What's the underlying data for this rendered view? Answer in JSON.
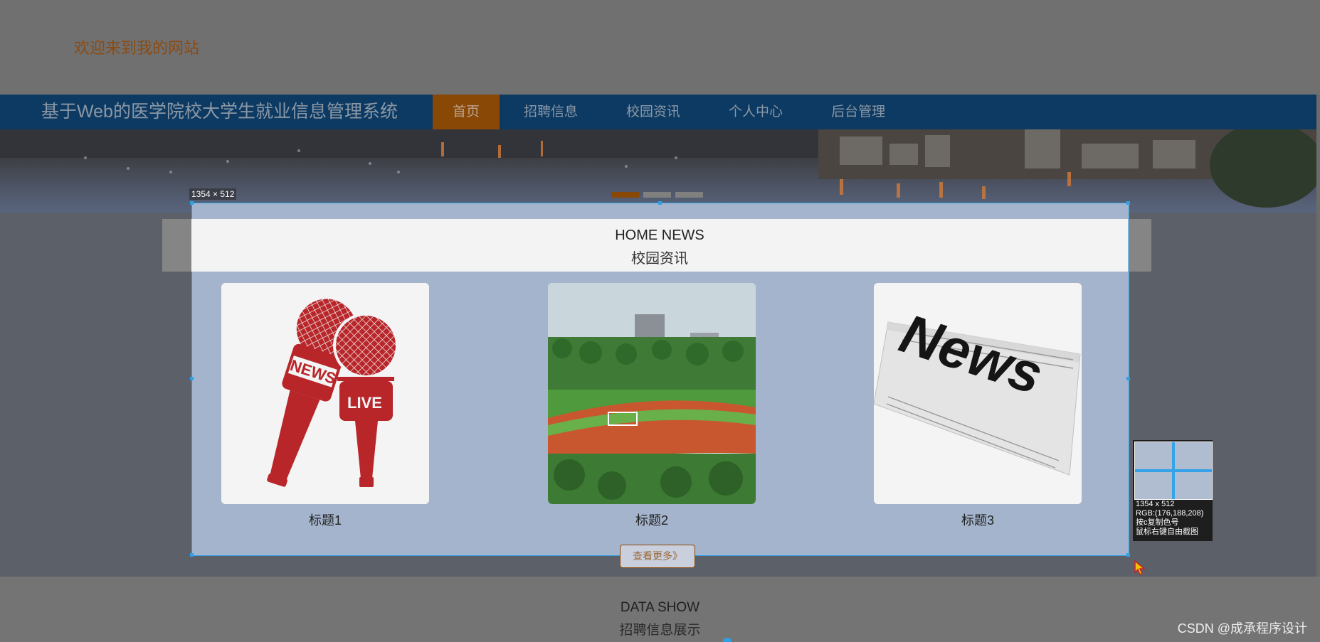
{
  "header": {
    "welcome": "欢迎来到我的网站"
  },
  "nav": {
    "site_title": "基于Web的医学院校大学生就业信息管理系统",
    "items": [
      {
        "label": "首页",
        "active": true
      },
      {
        "label": "招聘信息",
        "active": false
      },
      {
        "label": "校园资讯",
        "active": false
      },
      {
        "label": "个人中心",
        "active": false
      },
      {
        "label": "后台管理",
        "active": false
      }
    ]
  },
  "carousel": {
    "slides": 3,
    "active_slide": 1
  },
  "news": {
    "title_en": "HOME NEWS",
    "title_cn": "校园资讯",
    "cards": [
      {
        "title": "标题1",
        "image": "news-microphones-image",
        "mic_labels": [
          "NEWS",
          "LIVE"
        ]
      },
      {
        "title": "标题2",
        "image": "campus-track-image"
      },
      {
        "title": "标题3",
        "image": "newspaper-image",
        "paper_text": "News"
      }
    ],
    "more_label": "查看更多》"
  },
  "screenshot_tool": {
    "size_label": "1354 × 512",
    "magnifier": {
      "size": "1354 x 512",
      "rgb": "RGB:(176,188,208)",
      "hint_copy": "按c复制色号",
      "hint_right": "鼠标右键自由截图"
    }
  },
  "data_show": {
    "title_en": "DATA SHOW",
    "title_cn": "招聘信息展示"
  },
  "watermark": "CSDN @成承程序设计",
  "colors": {
    "nav_bg": "#0c3a63",
    "accent": "#8a4807",
    "selection_border": "#2fa0e6",
    "overlay": "#b0bcd0"
  }
}
